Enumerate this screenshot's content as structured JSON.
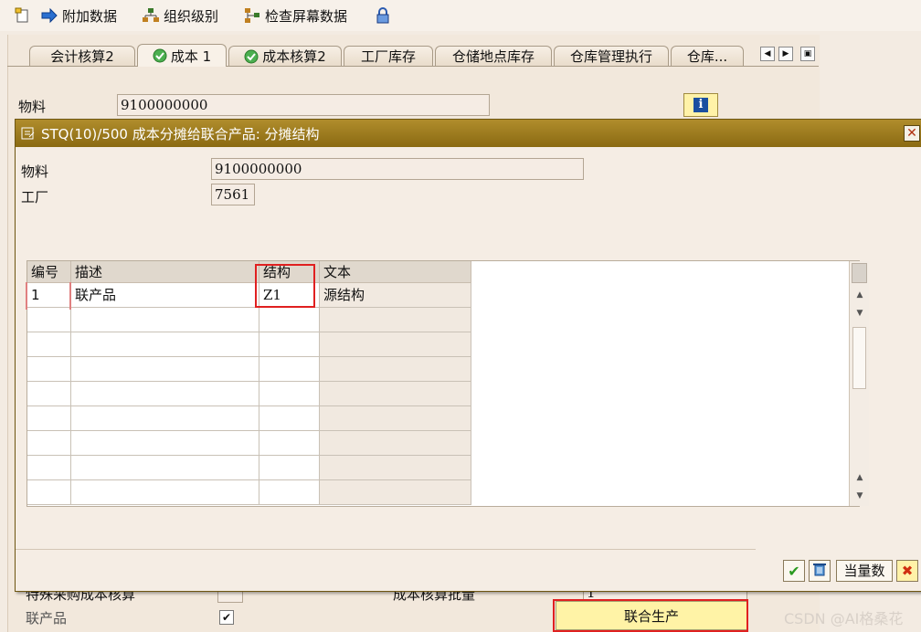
{
  "toolbar": {
    "additional_data": "附加数据",
    "org_levels": "组织级别",
    "check_screen_data": "检查屏幕数据"
  },
  "tabs": [
    {
      "label": "会计核算2"
    },
    {
      "label": "成本 1"
    },
    {
      "label": "成本核算2"
    },
    {
      "label": "工厂库存"
    },
    {
      "label": "仓储地点库存"
    },
    {
      "label": "仓库管理执行"
    },
    {
      "label": "仓库..."
    }
  ],
  "main": {
    "material_label": "物料",
    "material_value": "9100000000",
    "special_procurement_label": "特殊采购成本核算",
    "costing_lot_size_label": "成本核算批量",
    "costing_lot_size_value": "1",
    "co_product_label": "联产品",
    "joint_production_button": "联合生产"
  },
  "dialog": {
    "title": "STQ(10)/500 成本分摊给联合产品: 分摊结构",
    "material_label": "物料",
    "material_value": "9100000000",
    "plant_label": "工厂",
    "plant_value": "7561",
    "grid": {
      "headers": [
        "编号",
        "描述",
        "结构",
        "文本"
      ],
      "rows": [
        {
          "no": "1",
          "desc": "联产品",
          "struct": "Z1",
          "text": "源结构"
        }
      ]
    },
    "equivalent_numbers_button": "当量数"
  },
  "watermark": "CSDN @AI格桑花",
  "colors": {
    "title_bar": "#9a7a1e",
    "highlight": "#e02020",
    "button_yellow": "#fff3a6"
  }
}
